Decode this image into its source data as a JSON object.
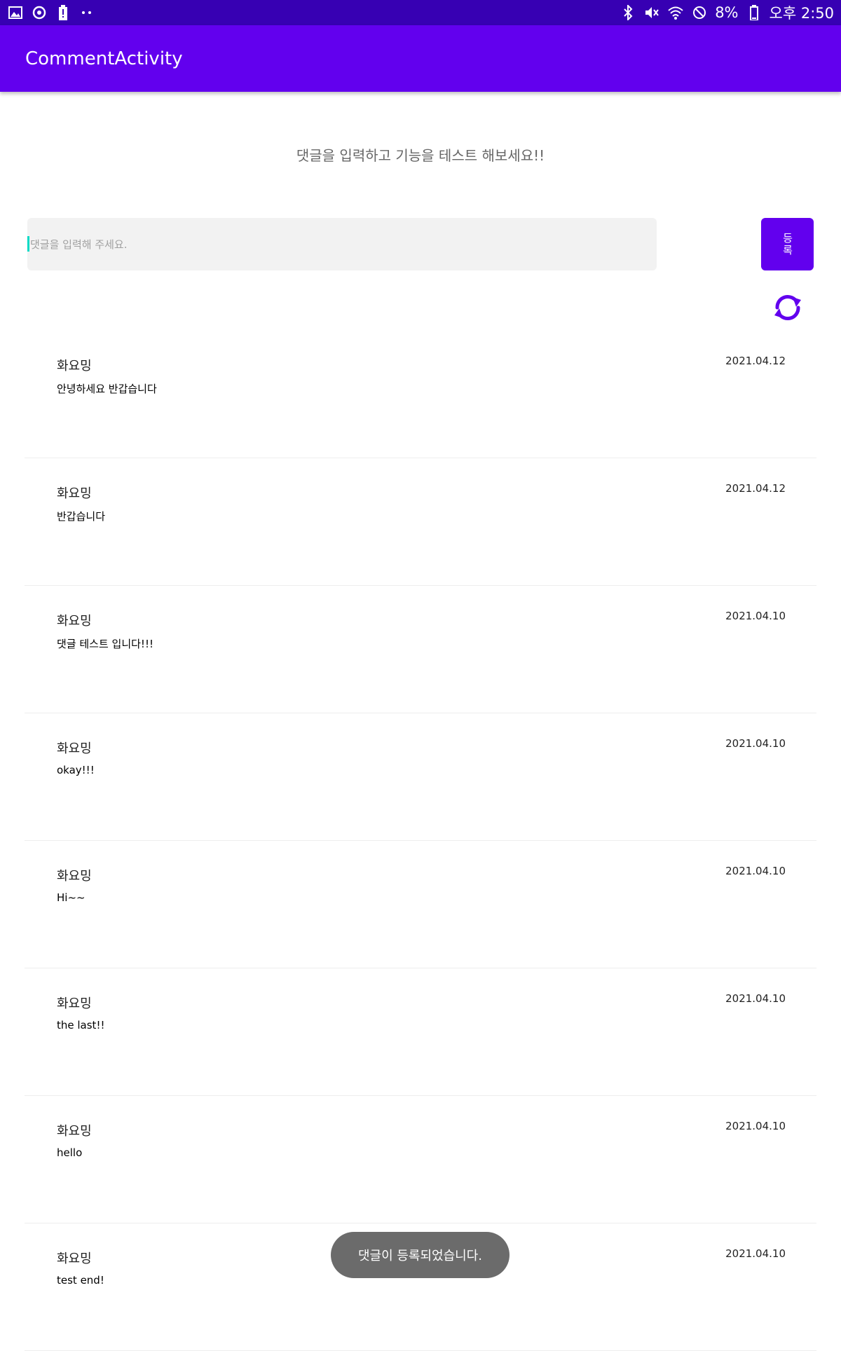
{
  "status_bar": {
    "battery_percent": "8%",
    "time": "오후 2:50",
    "left_icons": [
      "image-icon",
      "sync-icon",
      "battery-alert-icon",
      "more-dots-icon"
    ],
    "right_icons": [
      "bluetooth-icon",
      "mute-icon",
      "wifi-icon",
      "do-not-disturb-icon",
      "battery-icon"
    ]
  },
  "app_bar": {
    "title": "CommentActivity"
  },
  "instruction": "댓글을 입력하고 기능을 테스트 해보세요!!",
  "comment_input": {
    "placeholder": "댓글을 입력해 주세요.",
    "value": ""
  },
  "register_button": {
    "label": "등록"
  },
  "refresh_button": {
    "icon": "refresh-icon"
  },
  "comments": [
    {
      "author": "화요밍",
      "text": "안녕하세요 반갑습니다",
      "date": "2021.04.12"
    },
    {
      "author": "화요밍",
      "text": "반갑습니다",
      "date": "2021.04.12"
    },
    {
      "author": "화요밍",
      "text": "댓글 테스트 입니다!!!",
      "date": "2021.04.10"
    },
    {
      "author": "화요밍",
      "text": "okay!!!",
      "date": "2021.04.10"
    },
    {
      "author": "화요밍",
      "text": "Hi~~",
      "date": "2021.04.10"
    },
    {
      "author": "화요밍",
      "text": "the last!!",
      "date": "2021.04.10"
    },
    {
      "author": "화요밍",
      "text": "hello",
      "date": "2021.04.10"
    },
    {
      "author": "화요밍",
      "text": "test end!",
      "date": "2021.04.10"
    }
  ],
  "toast": {
    "message": "댓글이 등록되었습니다."
  },
  "colors": {
    "status_bar": "#3700b3",
    "primary": "#6200ee",
    "accent": "#03dac5",
    "input_background": "#f2f2f2",
    "toast_background": "#6b6b6b"
  }
}
